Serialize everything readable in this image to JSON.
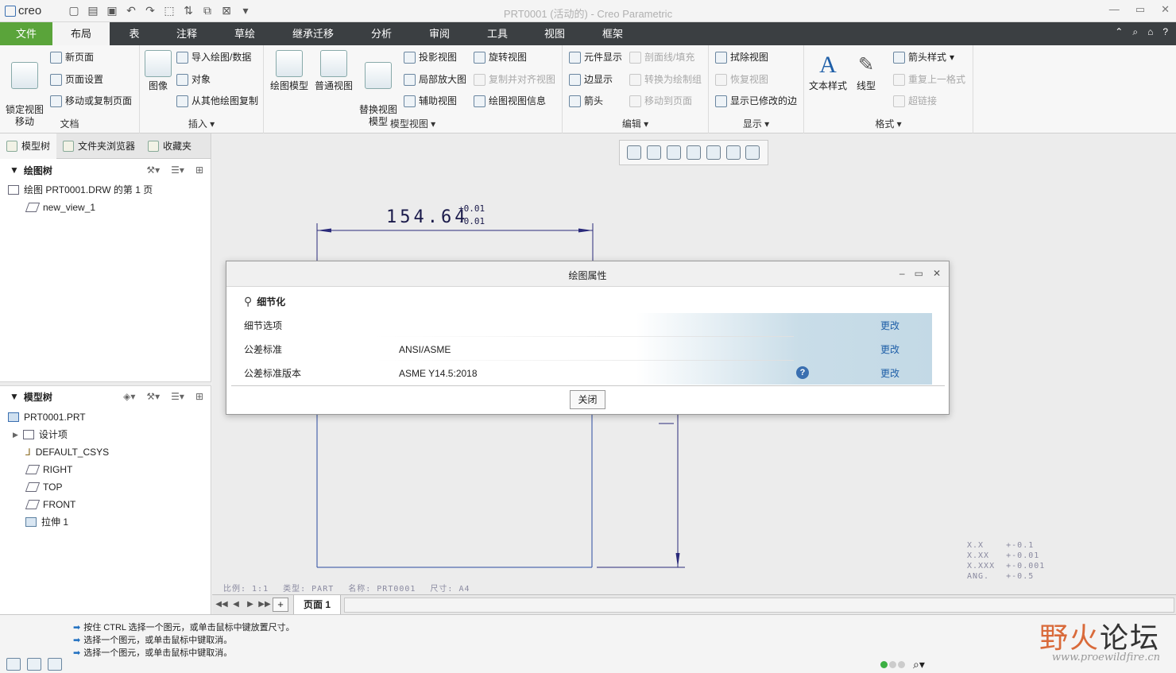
{
  "app": {
    "logo": "creo",
    "window_title": "PRT0001 (活动的) - Creo Parametric"
  },
  "tabs": {
    "file": "文件",
    "items": [
      "布局",
      "表",
      "注释",
      "草绘",
      "继承迁移",
      "分析",
      "审阅",
      "工具",
      "视图",
      "框架"
    ]
  },
  "ribbon": {
    "doc_group": {
      "title": "文档",
      "lock_view": "锁定视图\n移动",
      "new_page": "新页面",
      "page_setup": "页面设置",
      "move_copy_page": "移动或复制页面"
    },
    "insert_group": {
      "title": "插入",
      "image": "图像",
      "import": "导入绘图/数据",
      "object": "对象",
      "copy_from": "从其他绘图复制"
    },
    "model_views": {
      "title": "模型视图",
      "drawing_model": "绘图模型",
      "general_view": "普通视图",
      "replace_view": "替换视图\n模型",
      "projection_view": "投影视图",
      "detailed_view": "局部放大图",
      "auxiliary_view": "辅助视图",
      "revolved_view": "旋转视图",
      "copy_align": "复制并对齐视图",
      "view_info": "绘图视图信息"
    },
    "edit_group": {
      "title": "编辑",
      "component_display": "元件显示",
      "edge_display": "边显示",
      "arrow": "箭头",
      "section_fill": "剖面线/填充",
      "convert_group": "转换为绘制组",
      "move_to_page": "移动到页面"
    },
    "display_group": {
      "title": "显示",
      "erase_view": "拭除视图",
      "restore_view": "恢复视图",
      "show_modified_edges": "显示已修改的边"
    },
    "format_group": {
      "title": "格式",
      "text_style": "文本样式",
      "line_style": "线型",
      "arrow_style": "箭头样式",
      "repeat_format": "重复上一格式",
      "hyperlink": "超链接"
    }
  },
  "left_panel": {
    "tabs": [
      "模型树",
      "文件夹浏览器",
      "收藏夹"
    ],
    "drawing_tree": {
      "title": "绘图树",
      "items": [
        "绘图 PRT0001.DRW 的第 1 页",
        "new_view_1"
      ]
    },
    "model_tree": {
      "title": "模型树",
      "items": [
        "PRT0001.PRT",
        "设计项",
        "DEFAULT_CSYS",
        "RIGHT",
        "TOP",
        "FRONT",
        "拉伸 1"
      ]
    }
  },
  "canvas": {
    "dimension": "154.64",
    "tol_upper": "+0.01",
    "tol_lower": "-0.01",
    "tolerance_note": [
      "X.X    +-0.1",
      "X.XX   +-0.01",
      "X.XXX  +-0.001",
      "ANG.   +-0.5"
    ],
    "title_info": [
      "比例: 1:1",
      "类型: PART",
      "名称: PRT0001",
      "尺寸: A4"
    ]
  },
  "sheet": {
    "tab": "页面 1"
  },
  "dialog": {
    "title": "绘图属性",
    "section": "细节化",
    "rows": [
      {
        "name": "细节选项",
        "value": "",
        "action": "更改"
      },
      {
        "name": "公差标准",
        "value": "ANSI/ASME",
        "action": "更改"
      },
      {
        "name": "公差标准版本",
        "value": "ASME Y14.5:2018",
        "action": "更改"
      }
    ],
    "close": "关闭"
  },
  "messages": [
    "按住 CTRL 选择一个图元，或单击鼠标中键放置尺寸。",
    "选择一个图元，或单击鼠标中键取消。",
    "选择一个图元，或单击鼠标中键取消。"
  ],
  "watermark": {
    "cn_a": "野火",
    "cn_b": "论坛",
    "url": "www.proewildfire.cn"
  },
  "colors": {
    "file_tab": "#5aa43a",
    "tab_bar": "#3b3f42",
    "link": "#1f5fa8",
    "drawing_line": "#2a2a7a"
  }
}
